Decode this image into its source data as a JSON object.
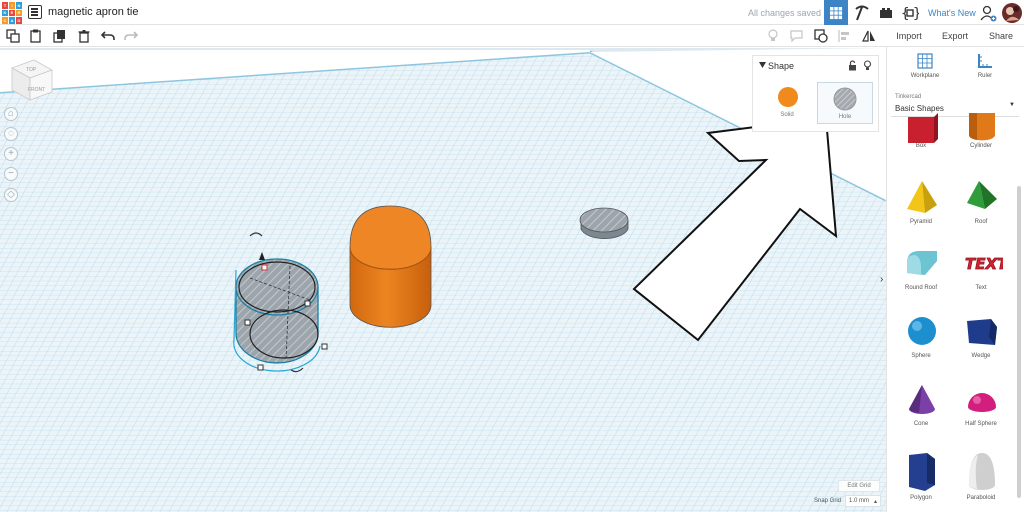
{
  "app": {
    "logo_letters": [
      "T",
      "I",
      "N",
      "K",
      "E",
      "R",
      "C",
      "A",
      "D"
    ],
    "logo_colors": [
      "#e8473f",
      "#f49a26",
      "#2f9fd8",
      "#2f9fd8",
      "#e8473f",
      "#f49a26",
      "#f49a26",
      "#2f9fd8",
      "#e8473f"
    ],
    "title": "magnetic apron tie",
    "save_status": "All changes saved",
    "whats_new": "What's New",
    "accent": "#3d84c6"
  },
  "actions": {
    "import": "Import",
    "export": "Export",
    "share": "Share"
  },
  "inspector": {
    "title": "Shape",
    "solid_label": "Solid",
    "hole_label": "Hole",
    "solid_color": "#f08a1c"
  },
  "grid_controls": {
    "edit_grid": "Edit Grid",
    "snap_label": "Snap Grid",
    "snap_value": "1.0 mm"
  },
  "panel": {
    "workplane": "Workplane",
    "ruler": "Ruler",
    "library_small": "Tinkercad",
    "library_name": "Basic Shapes",
    "shapes": [
      {
        "label": "Box",
        "icon": "box-icon",
        "color": "#c8202e"
      },
      {
        "label": "Cylinder",
        "icon": "cylinder-icon",
        "color": "#e07a18"
      },
      {
        "label": "Pyramid",
        "icon": "pyramid-icon",
        "color": "#f2c618"
      },
      {
        "label": "Roof",
        "icon": "roof-icon",
        "color": "#2e9d3a"
      },
      {
        "label": "Round Roof",
        "icon": "round-roof-icon",
        "color": "#6cc3d2"
      },
      {
        "label": "Text",
        "icon": "text-icon",
        "color": "#d6232f"
      },
      {
        "label": "Sphere",
        "icon": "sphere-icon",
        "color": "#1d8fcf"
      },
      {
        "label": "Wedge",
        "icon": "wedge-icon",
        "color": "#1f3c8c"
      },
      {
        "label": "Cone",
        "icon": "cone-icon",
        "color": "#7b3fa8"
      },
      {
        "label": "Half Sphere",
        "icon": "half-sphere-icon",
        "color": "#d21f7e"
      },
      {
        "label": "Polygon",
        "icon": "polygon-icon",
        "color": "#243f8f"
      },
      {
        "label": "Paraboloid",
        "icon": "paraboloid-icon",
        "color": "#cfcfcf"
      }
    ]
  },
  "viewcube": {
    "top": "TOP",
    "front": "FRONT"
  },
  "text_shape_glyphs": "TEXT"
}
